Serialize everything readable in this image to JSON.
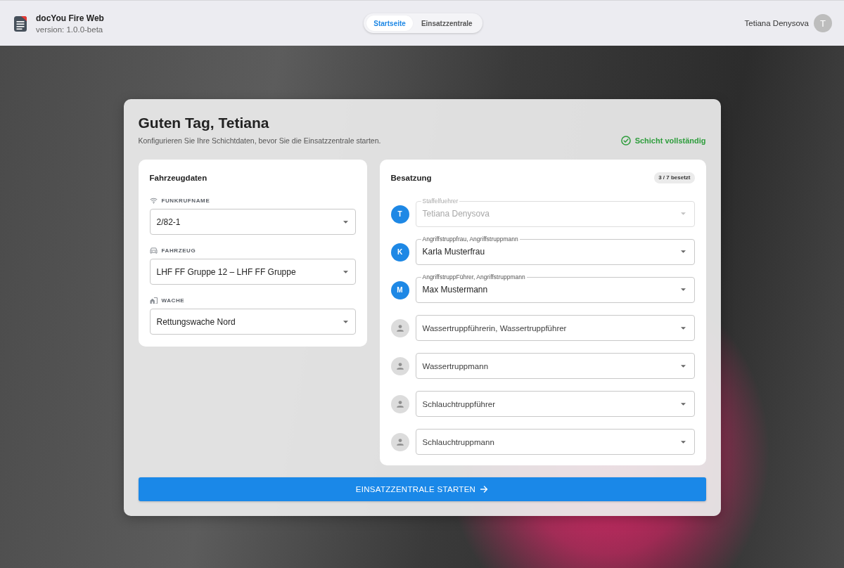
{
  "header": {
    "app_title": "docYou Fire Web",
    "version": "version: 1.0.0-beta",
    "tabs": [
      {
        "label": "Startseite",
        "selected": true
      },
      {
        "label": "Einsatzzentrale",
        "selected": false
      }
    ],
    "user": {
      "name": "Tetiana Denysova",
      "initial": "T"
    }
  },
  "greeting": {
    "title": "Guten Tag, Tetiana",
    "subtitle": "Konfigurieren Sie Ihre Schichtdaten, bevor Sie die Einsatzzentrale starten.",
    "status": "Schicht vollständig"
  },
  "vehicle_panel": {
    "title": "Fahrzeugdaten",
    "fields": [
      {
        "label": "FUNKRUFNAME",
        "value": "2/82-1"
      },
      {
        "label": "FAHRZEUG",
        "value": "LHF FF Gruppe 12 – LHF FF Gruppe"
      },
      {
        "label": "WACHE",
        "value": "Rettungswache Nord"
      }
    ]
  },
  "crew_panel": {
    "title": "Besatzung",
    "badge": "3 / 7 besetzt",
    "members": [
      {
        "initial": "T",
        "label": "Staffelfuehrer",
        "value": "Tetiana Denysova",
        "disabled": true
      },
      {
        "initial": "K",
        "label": "Angriffstruppfrau, Angriffstruppmann",
        "value": "Karla Musterfrau",
        "disabled": false
      },
      {
        "initial": "M",
        "label": "AngriffstruppFührer, Angriffstruppmann",
        "value": "Max Mustermann",
        "disabled": false
      },
      {
        "placeholder": "Wassertruppführerin, Wassertruppführer",
        "disabled": false
      },
      {
        "placeholder": "Wassertruppmann",
        "disabled": false
      },
      {
        "placeholder": "Schlauchtruppführer",
        "disabled": false
      },
      {
        "placeholder": "Schlauchtruppmann",
        "disabled": false
      }
    ]
  },
  "start_button": {
    "label": "EINSATZZENTRALE STARTEN"
  }
}
